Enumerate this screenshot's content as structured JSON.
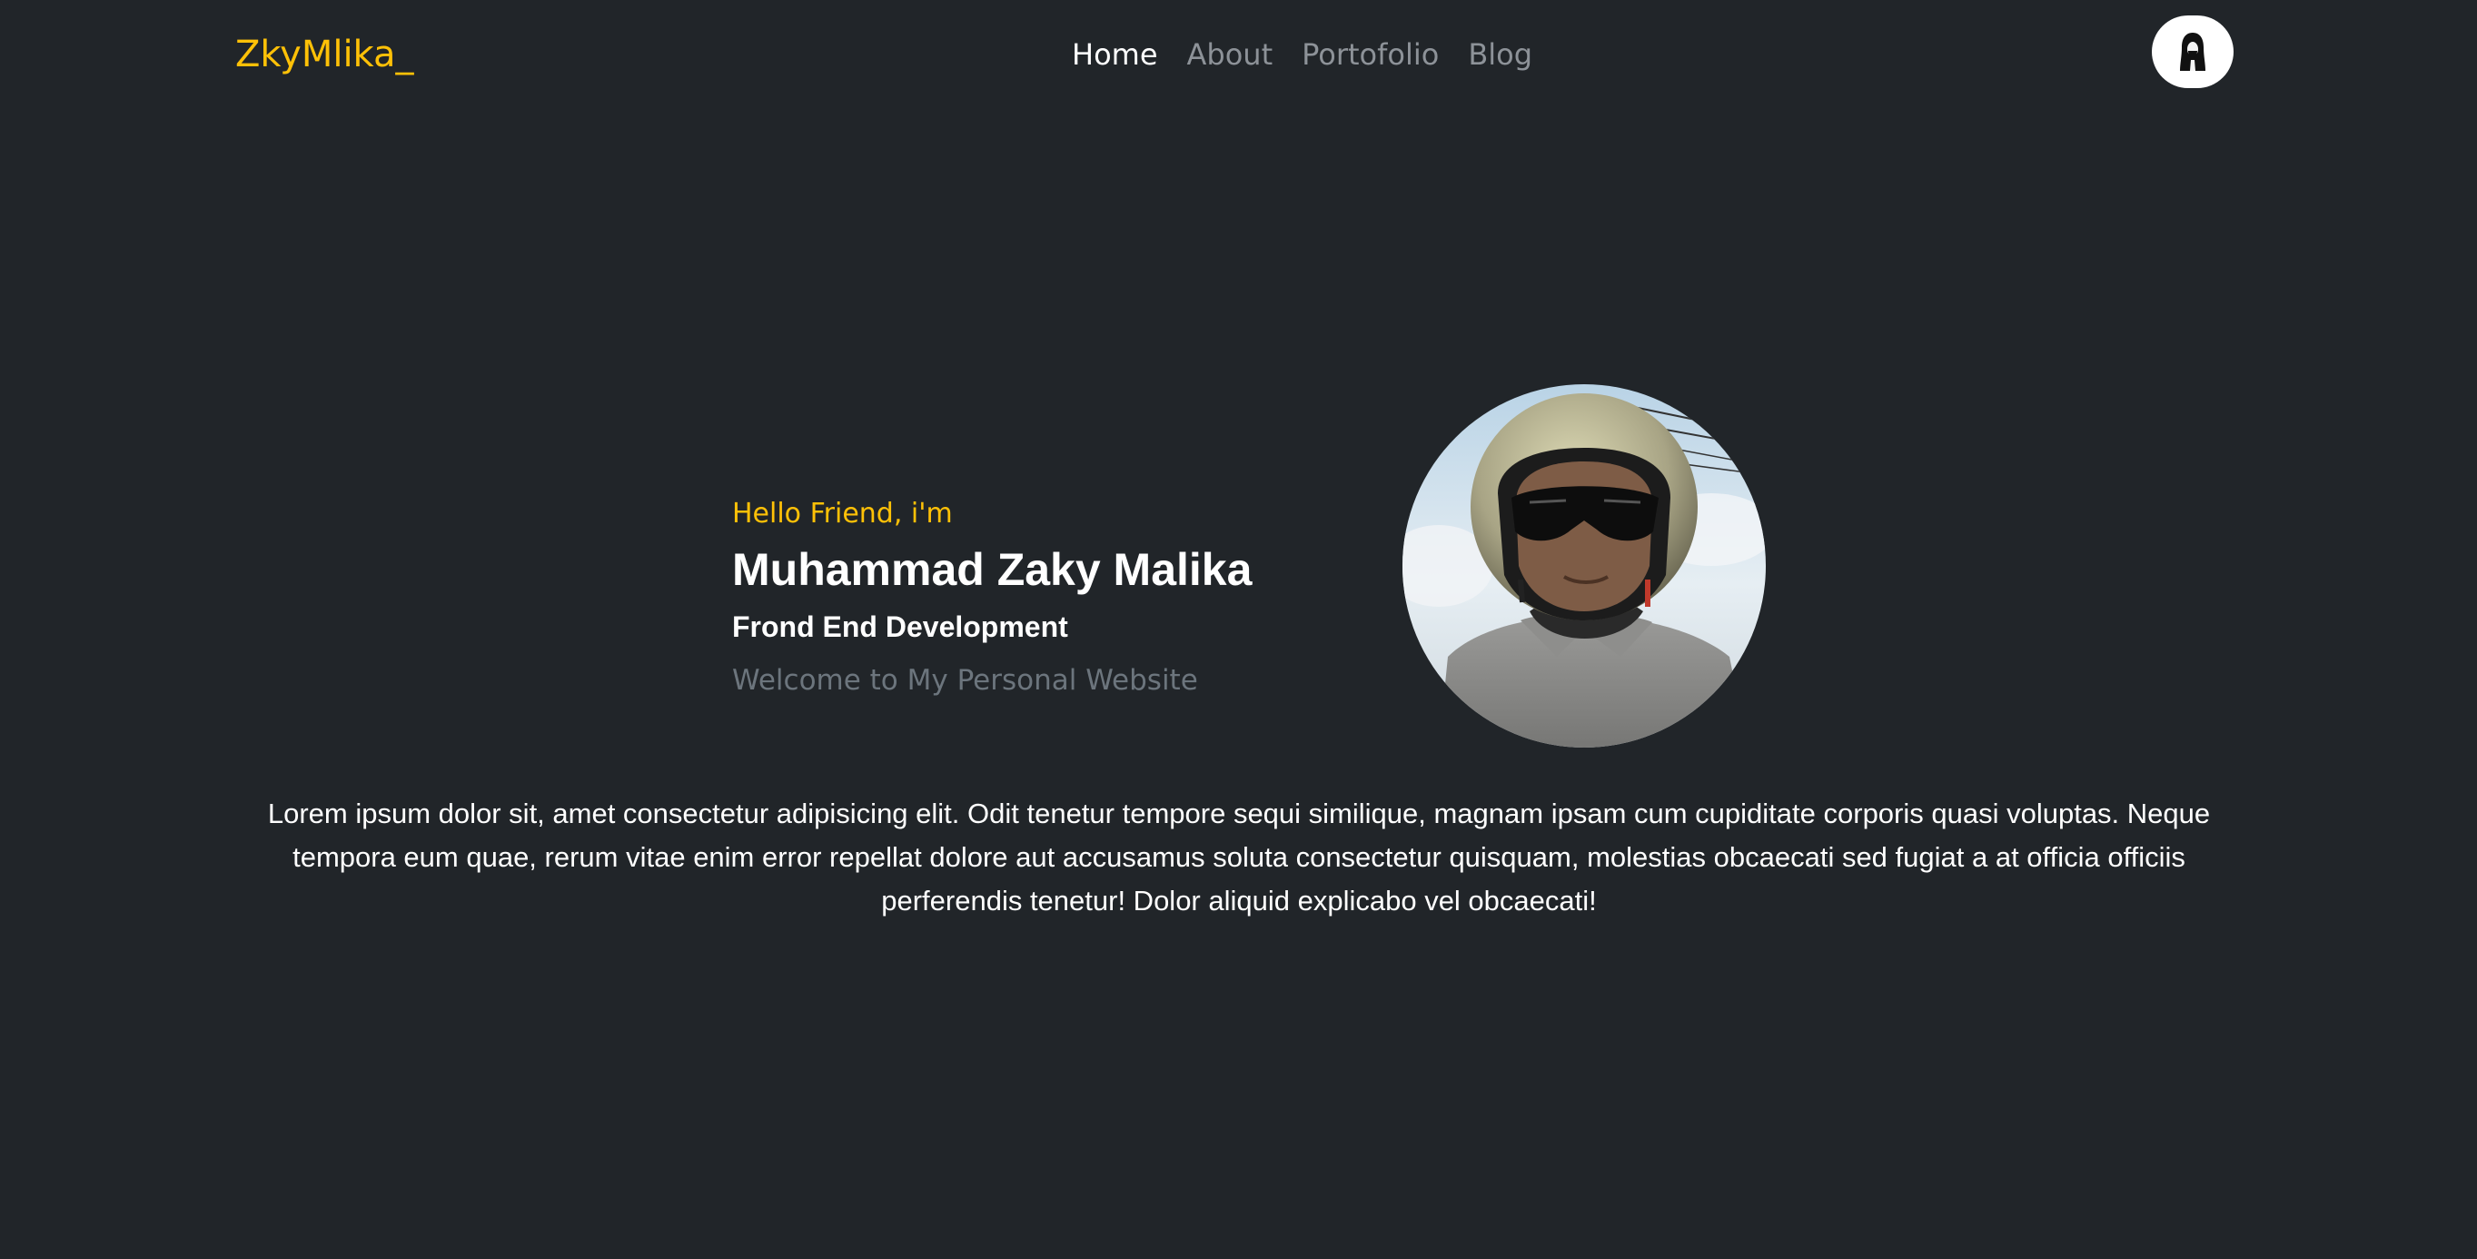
{
  "navbar": {
    "brand": "ZkyMlika_",
    "links": [
      {
        "label": "Home",
        "active": true
      },
      {
        "label": "About",
        "active": false
      },
      {
        "label": "Portofolio",
        "active": false
      },
      {
        "label": "Blog",
        "active": false
      }
    ],
    "avatar_icon": "user-avatar-icon"
  },
  "hero": {
    "greeting": "Hello Friend, i'm",
    "name": "Muhammad Zaky Malika",
    "role": "Frond End Development",
    "welcome": "Welcome to My Personal Website",
    "photo_icon": "profile-photo"
  },
  "intro": {
    "text": "Lorem ipsum dolor sit, amet consectetur adipisicing elit. Odit tenetur tempore sequi similique, magnam ipsam cum cupiditate corporis quasi voluptas. Neque tempora eum quae, rerum vitae enim error repellat dolore aut accusamus soluta consectetur quisquam, molestias obcaecati sed fugiat a at officia officiis perferendis tenetur! Dolor aliquid explicabo vel obcaecati!"
  },
  "colors": {
    "background": "#212529",
    "accent": "#ffc107",
    "muted_text": "#6c757d",
    "nav_inactive": "#8d9298",
    "text": "#ffffff"
  }
}
